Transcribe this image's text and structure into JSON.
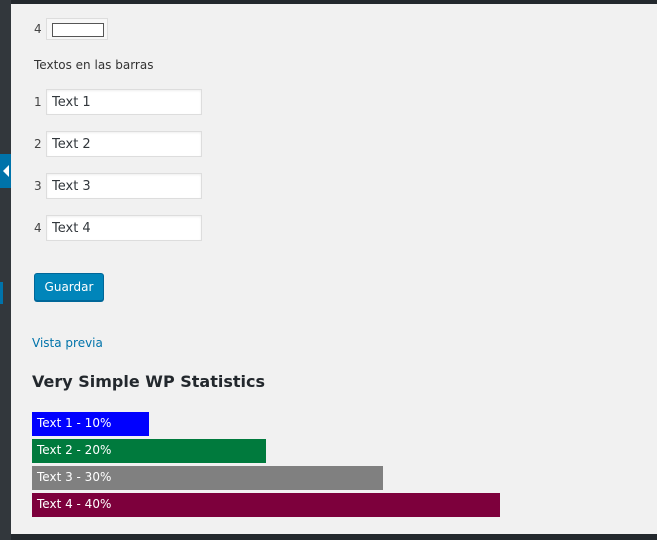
{
  "color_row": {
    "index": "4",
    "color": "#ffffff"
  },
  "bar_texts_section": {
    "title": "Textos en las barras",
    "rows": [
      {
        "index": "1",
        "value": "Text 1"
      },
      {
        "index": "2",
        "value": "Text 2"
      },
      {
        "index": "3",
        "value": "Text 3"
      },
      {
        "index": "4",
        "value": "Text 4"
      }
    ]
  },
  "save_label": "Guardar",
  "preview_link": "Vista previa",
  "widget_title": "Very Simple WP Statistics",
  "chart_data": {
    "type": "bar",
    "orientation": "horizontal",
    "scale_max_percent": 50,
    "bars": [
      {
        "label": "Text 1 - 10%",
        "value": 10,
        "color": "#0000ff"
      },
      {
        "label": "Text 2 - 20%",
        "value": 20,
        "color": "#007a3d"
      },
      {
        "label": "Text 3 - 30%",
        "value": 30,
        "color": "#808080"
      },
      {
        "label": "Text 4 - 40%",
        "value": 40,
        "color": "#7d003c"
      }
    ]
  },
  "theme": {
    "accent": "#0073aa",
    "button": "#0085ba"
  }
}
